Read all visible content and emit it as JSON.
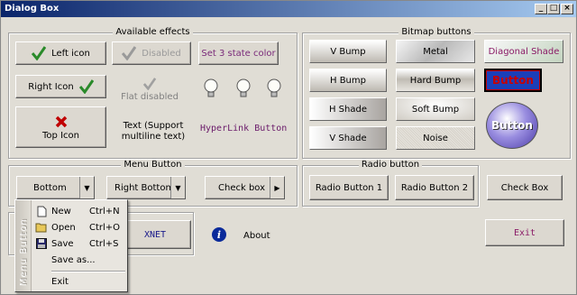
{
  "window": {
    "title": "Dialog Box",
    "min": "_",
    "max": "□",
    "close": "×"
  },
  "groups": {
    "available_effects": "Available effects",
    "bitmap_buttons": "Bitmap buttons",
    "menu_button": "Menu Button",
    "radio_button": "Radio button"
  },
  "effects": {
    "left_icon": "Left icon",
    "disabled": "Disabled",
    "set_3_state_color": "Set 3 state color",
    "right_icon": "Right Icon",
    "flat_disabled": "Flat disabled",
    "top_icon": "Top Icon",
    "text_multiline": "Text (Support multiline text)",
    "hyperlink_button": "HyperLink Button"
  },
  "bitmap": {
    "v_bump": "V Bump",
    "metal": "Metal",
    "diagonal_shade": "Diagonal Shade",
    "h_bump": "H Bump",
    "hard_bump": "Hard Bump",
    "button_label": "Button",
    "h_shade": "H Shade",
    "soft_bump": "Soft Bump",
    "round_button": "Button",
    "v_shade": "V Shade",
    "noise": "Noise"
  },
  "menu_buttons": {
    "bottom": "Bottom",
    "right_bottom": "Right Bottom",
    "check_box": "Check box"
  },
  "radio": {
    "button1": "Radio Button 1",
    "button2": "Radio Button 2"
  },
  "check_box_button": "Check Box",
  "xnet": "XNET",
  "about": "About",
  "exit": "Exit",
  "popup_menu": {
    "strip_label": "Menu Button",
    "items": [
      {
        "label": "New",
        "shortcut": "Ctrl+N",
        "icon": "new-file-icon"
      },
      {
        "label": "Open",
        "shortcut": "Ctrl+O",
        "icon": "open-folder-icon"
      },
      {
        "label": "Save",
        "shortcut": "Ctrl+S",
        "icon": "floppy-disk-icon"
      },
      {
        "label": "Save as...",
        "shortcut": ""
      },
      {
        "label": "Exit",
        "shortcut": ""
      }
    ]
  },
  "colors": {
    "titlebar_start": "#0a246a",
    "titlebar_end": "#a6caf0",
    "hyperlink": "#6a1a6a",
    "exit_text": "#8a1a66",
    "blue_button": "#1c3fb8",
    "button_text_red": "#c80000"
  }
}
